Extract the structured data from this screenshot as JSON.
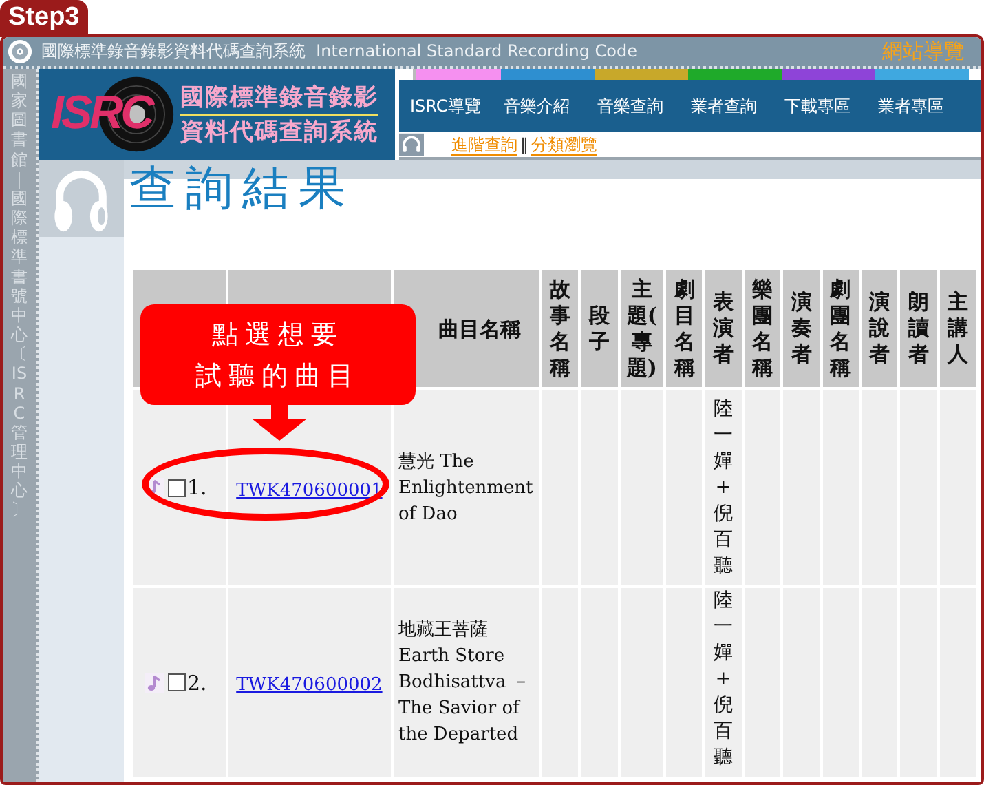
{
  "step_badge": {
    "text": "Step3"
  },
  "top_bar": {
    "title": "國際標準錄音錄影資料代碼查詢系統  International Standard Recording Code",
    "site_map": "網站導覽"
  },
  "sidebar": {
    "text": "國家圖書館｜國際標準書號中心〔ISRC管理中心〕"
  },
  "logo": {
    "mark": "ISRC",
    "lines": [
      "國際標準錄音錄影",
      "資料代碼查詢系統"
    ]
  },
  "nav": {
    "items": [
      {
        "label": "ISRC導覽"
      },
      {
        "label": "音樂介紹"
      },
      {
        "label": "音樂查詢"
      },
      {
        "label": "業者查詢"
      },
      {
        "label": "下載專區"
      },
      {
        "label": "業者專區"
      }
    ],
    "sub_links": [
      {
        "label": "進階查詢"
      },
      {
        "label": "分類瀏覽"
      }
    ],
    "sub_separator": "‖"
  },
  "page_title": "查詢結果",
  "table": {
    "columns": [
      {
        "label": "曲目名稱",
        "kind": "title"
      },
      {
        "label": "故事名稱",
        "kind": "empty"
      },
      {
        "label": "段子",
        "kind": "empty"
      },
      {
        "label": "主題(專題)",
        "kind": "empty"
      },
      {
        "label": "劇目名稱",
        "kind": "empty"
      },
      {
        "label": "表演者",
        "kind": "performer"
      },
      {
        "label": "樂團名稱",
        "kind": "empty"
      },
      {
        "label": "演奏者",
        "kind": "empty"
      },
      {
        "label": "劇團名稱",
        "kind": "empty"
      },
      {
        "label": "演說者",
        "kind": "empty"
      },
      {
        "label": "朗讀者",
        "kind": "empty"
      },
      {
        "label": "主講人",
        "kind": "empty"
      }
    ],
    "rows": [
      {
        "number": "1.",
        "checked": false,
        "isrc": "TWK470600001",
        "title": "慧光 The Enlightenment of Dao",
        "performer": "陸一嬋+倪百聽"
      },
      {
        "number": "2.",
        "checked": false,
        "isrc": "TWK470600002",
        "title": "地藏王菩薩 Earth Store Bodhisattva － The Savior of the Departed",
        "performer": "陸一嬋+倪百聽"
      }
    ]
  },
  "callout": {
    "lines": [
      "點選想要",
      "試聽的曲目"
    ]
  }
}
